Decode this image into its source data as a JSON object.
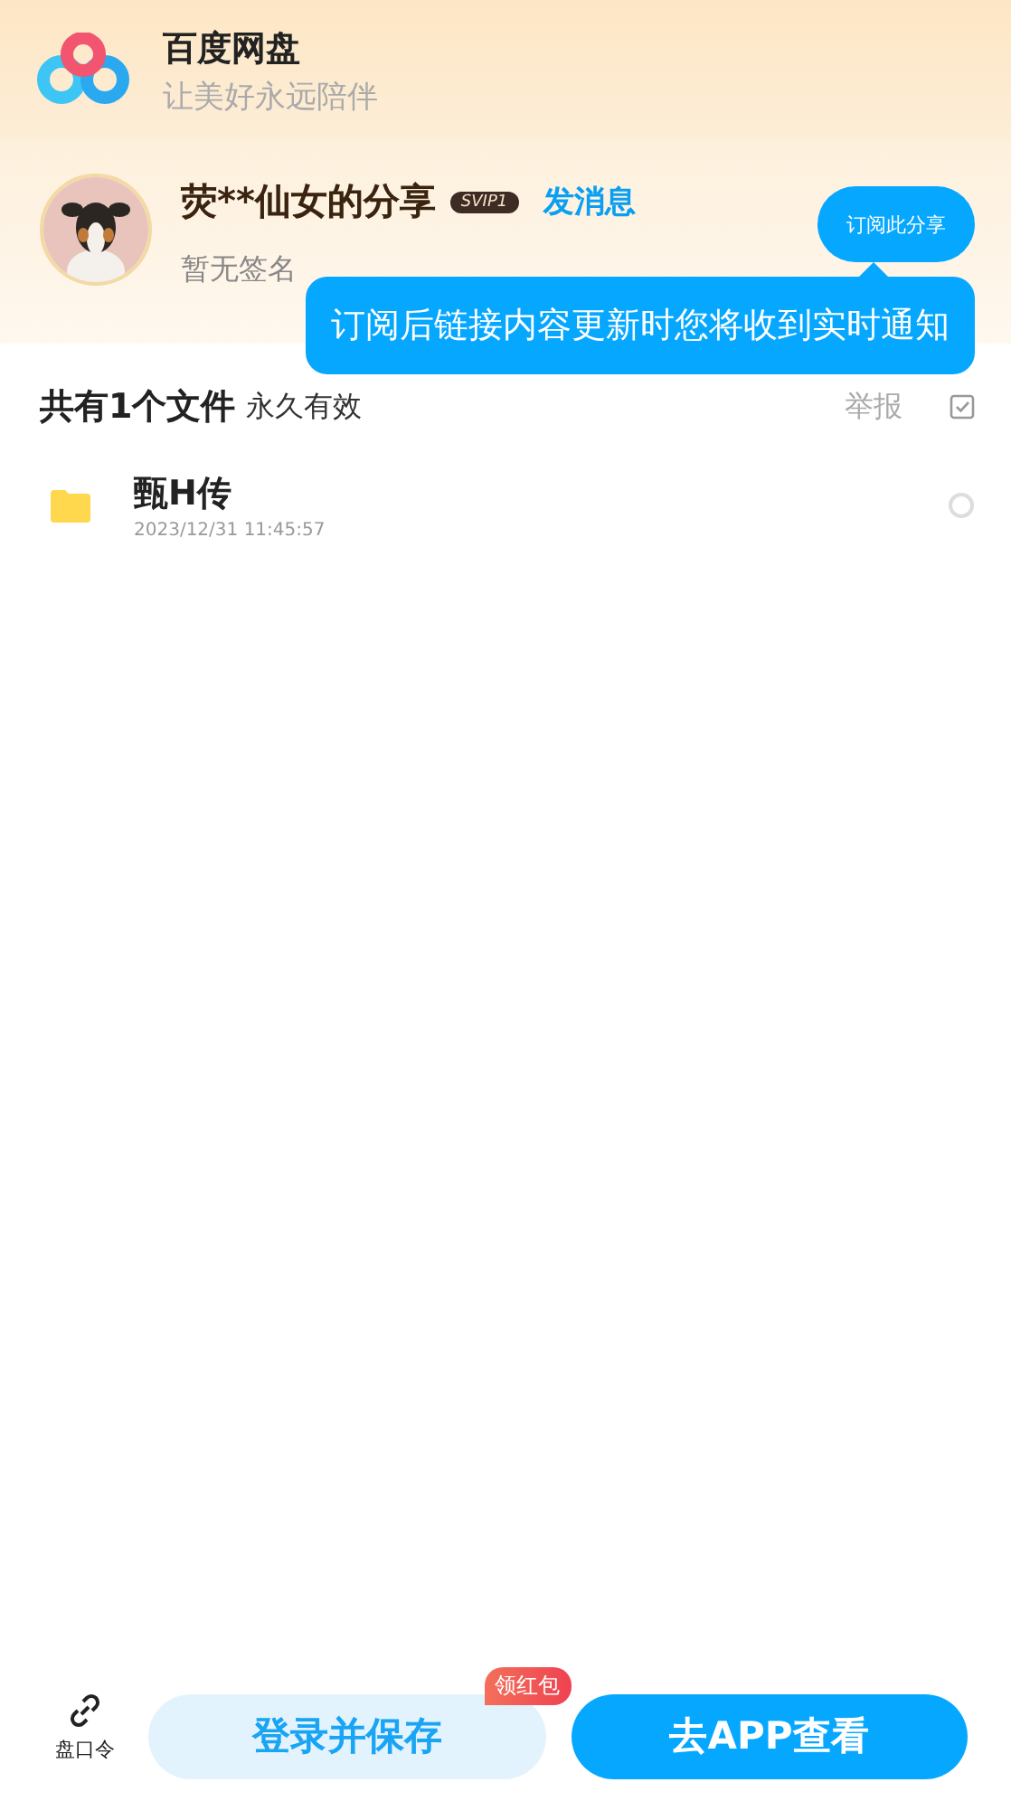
{
  "app": {
    "name": "百度网盘",
    "slogan": "让美好永远陪伴"
  },
  "share": {
    "title": "荧**仙女的分享",
    "vip_badge": "SVIP1",
    "message_link": "发消息",
    "signature": "暂无签名",
    "subscribe_button": "订阅此分享",
    "tooltip": "订阅后链接内容更新时您将收到实时通知"
  },
  "file_list": {
    "count_label": "共有1个文件",
    "validity": "永久有效",
    "report_link": "举报",
    "files": [
      {
        "name": "甄H传",
        "date": "2023/12/31 11:45:57",
        "selected": false
      }
    ]
  },
  "bottom_bar": {
    "code_label": "盘口令",
    "save_button": "登录并保存",
    "save_badge": "领红包",
    "open_app_button": "去APP查看"
  }
}
